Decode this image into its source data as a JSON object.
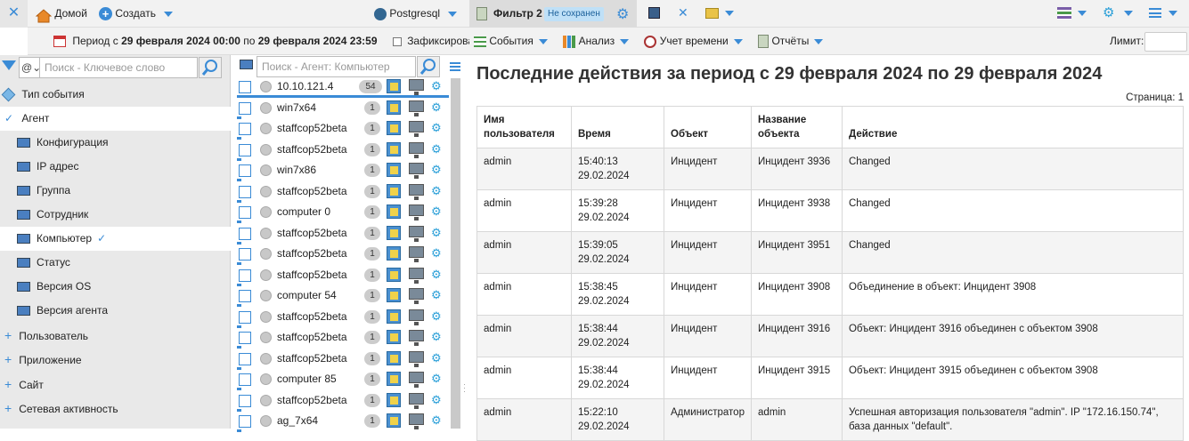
{
  "topbar": {
    "home": "Домой",
    "create": "Создать",
    "db": "Postgresql",
    "filter_tab": "Фильтр 2",
    "unsaved": "Не сохранен"
  },
  "period": {
    "prefix": "Период с",
    "from": "29 февраля 2024 00:00",
    "mid": "по",
    "to": "29 февраля 2024 23:59",
    "fix": "Зафиксировать"
  },
  "toolbar2": {
    "events": "События",
    "analysis": "Анализ",
    "time": "Учет времени",
    "reports": "Отчёты",
    "limit": "Лимит:"
  },
  "left": {
    "search_placeholder": "Поиск - Ключевое слово",
    "items": [
      {
        "label": "Тип события"
      },
      {
        "label": "Агент"
      },
      {
        "label": "Конфигурация"
      },
      {
        "label": "IP адрес"
      },
      {
        "label": "Группа"
      },
      {
        "label": "Сотрудник"
      },
      {
        "label": "Компьютер"
      },
      {
        "label": "Статус"
      },
      {
        "label": "Версия OS"
      },
      {
        "label": "Версия агента"
      },
      {
        "label": "Пользователь"
      },
      {
        "label": "Приложение"
      },
      {
        "label": "Сайт"
      },
      {
        "label": "Сетевая активность"
      }
    ]
  },
  "agents": {
    "search_placeholder": "Поиск - Агент: Компьютер",
    "rows": [
      {
        "name": "10.10.121.4",
        "count": "54"
      },
      {
        "name": "win7x64",
        "count": "1"
      },
      {
        "name": "staffcop52beta",
        "count": "1"
      },
      {
        "name": "staffcop52beta",
        "count": "1"
      },
      {
        "name": "win7x86",
        "count": "1"
      },
      {
        "name": "staffcop52beta",
        "count": "1"
      },
      {
        "name": "computer 0",
        "count": "1"
      },
      {
        "name": "staffcop52beta",
        "count": "1"
      },
      {
        "name": "staffcop52beta",
        "count": "1"
      },
      {
        "name": "staffcop52beta",
        "count": "1"
      },
      {
        "name": "computer 54",
        "count": "1"
      },
      {
        "name": "staffcop52beta",
        "count": "1"
      },
      {
        "name": "staffcop52beta",
        "count": "1"
      },
      {
        "name": "staffcop52beta",
        "count": "1"
      },
      {
        "name": "computer 85",
        "count": "1"
      },
      {
        "name": "staffcop52beta",
        "count": "1"
      },
      {
        "name": "ag_7x64",
        "count": "1"
      }
    ]
  },
  "report": {
    "title": "Последние действия за период с 29 февраля 2024 по 29 февраля 2024",
    "page": "Страница: 1",
    "headers": [
      "Имя пользователя",
      "Время",
      "Объект",
      "Название объекта",
      "Действие"
    ],
    "rows": [
      {
        "user": "admin",
        "time": "15:40:13",
        "date": "29.02.2024",
        "object": "Инцидент",
        "name": "Инцидент 3936",
        "action": "Changed"
      },
      {
        "user": "admin",
        "time": "15:39:28",
        "date": "29.02.2024",
        "object": "Инцидент",
        "name": "Инцидент 3938",
        "action": "Changed"
      },
      {
        "user": "admin",
        "time": "15:39:05",
        "date": "29.02.2024",
        "object": "Инцидент",
        "name": "Инцидент 3951",
        "action": "Changed"
      },
      {
        "user": "admin",
        "time": "15:38:45",
        "date": "29.02.2024",
        "object": "Инцидент",
        "name": "Инцидент 3908",
        "action": "Объединение в объект: Инцидент 3908"
      },
      {
        "user": "admin",
        "time": "15:38:44",
        "date": "29.02.2024",
        "object": "Инцидент",
        "name": "Инцидент 3916",
        "action": "Объект: Инцидент 3916 объединен с объектом 3908"
      },
      {
        "user": "admin",
        "time": "15:38:44",
        "date": "29.02.2024",
        "object": "Инцидент",
        "name": "Инцидент 3915",
        "action": "Объект: Инцидент 3915 объединен с объектом 3908"
      },
      {
        "user": "admin",
        "time": "15:22:10",
        "date": "29.02.2024",
        "object": "Администратор",
        "name": "admin",
        "action": "Успешная авторизация пользователя \"admin\". IP \"172.16.150.74\", база данных \"default\"."
      }
    ]
  }
}
